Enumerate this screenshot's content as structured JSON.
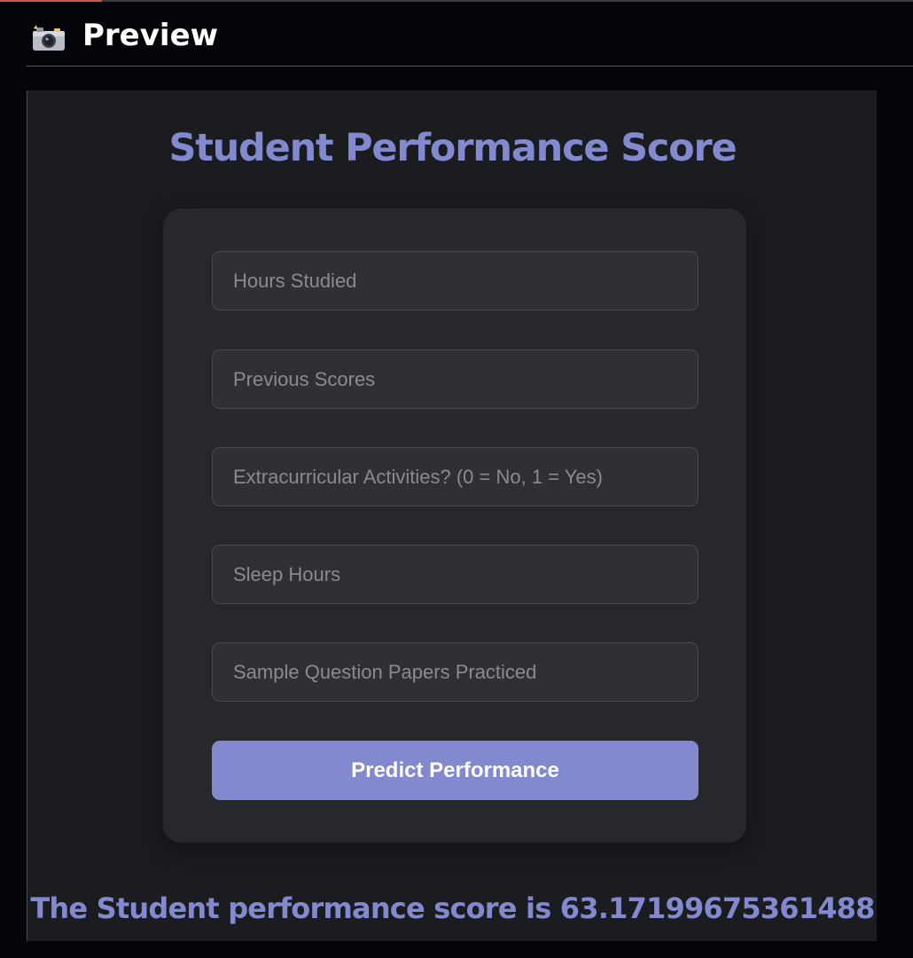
{
  "header": {
    "icon": "camera-icon",
    "title": "Preview"
  },
  "app": {
    "title": "Student Performance Score",
    "fields": [
      {
        "name": "hours-studied",
        "placeholder": "Hours Studied",
        "value": ""
      },
      {
        "name": "previous-scores",
        "placeholder": "Previous Scores",
        "value": ""
      },
      {
        "name": "extracurricular",
        "placeholder": "Extracurricular Activities? (0 = No, 1 = Yes)",
        "value": ""
      },
      {
        "name": "sleep-hours",
        "placeholder": "Sleep Hours",
        "value": ""
      },
      {
        "name": "sample-papers",
        "placeholder": "Sample Question Papers Practiced",
        "value": ""
      }
    ],
    "button_label": "Predict Performance",
    "result_text": "The Student performance score is 63.17199675361488"
  },
  "colors": {
    "accent": "#8289cf",
    "background": "#1b1c1f",
    "card": "#27282d",
    "outer": "#040509"
  }
}
